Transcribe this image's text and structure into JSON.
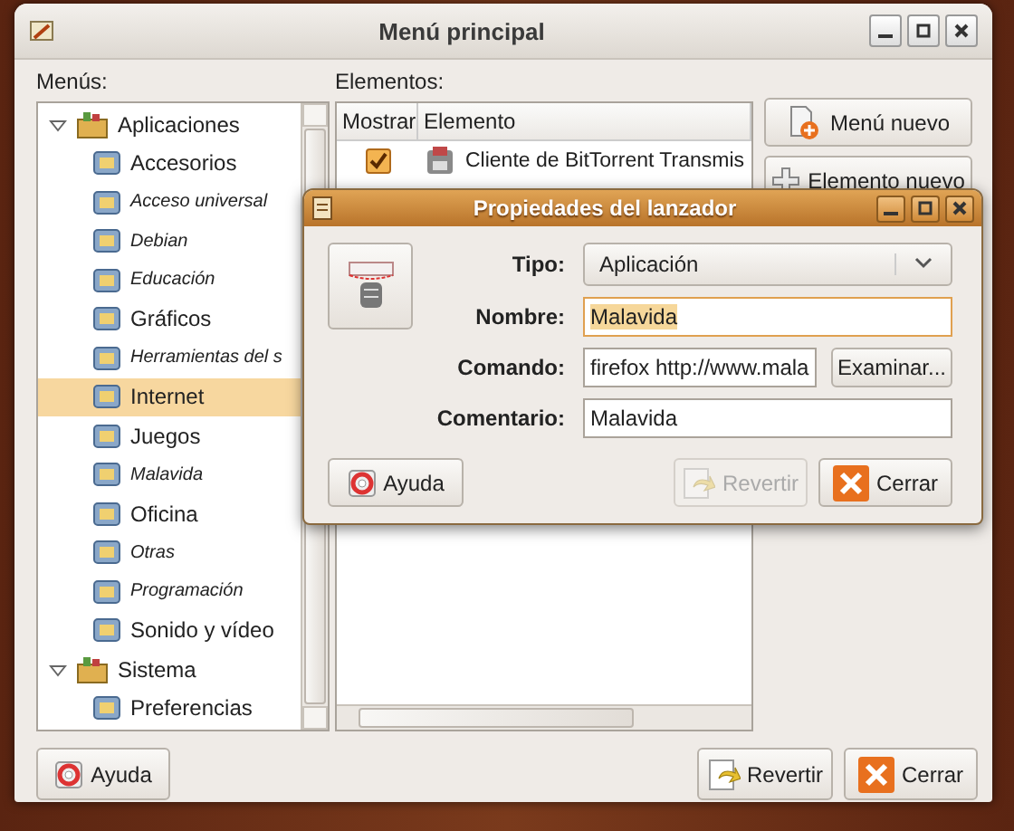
{
  "window": {
    "title": "Menú principal"
  },
  "menus": {
    "label": "Menús:",
    "tree": [
      {
        "label": "Aplicaciones",
        "expanded": true,
        "selected": false,
        "hidden": false,
        "children": [
          {
            "label": "Accesorios",
            "selected": false,
            "hidden": false
          },
          {
            "label": "Acceso universal",
            "selected": false,
            "hidden": true
          },
          {
            "label": "Debian",
            "selected": false,
            "hidden": true
          },
          {
            "label": "Educación",
            "selected": false,
            "hidden": true
          },
          {
            "label": "Gráficos",
            "selected": false,
            "hidden": false
          },
          {
            "label": "Herramientas del s",
            "selected": false,
            "hidden": true
          },
          {
            "label": "Internet",
            "selected": true,
            "hidden": false
          },
          {
            "label": "Juegos",
            "selected": false,
            "hidden": false
          },
          {
            "label": "Malavida",
            "selected": false,
            "hidden": true
          },
          {
            "label": "Oficina",
            "selected": false,
            "hidden": false
          },
          {
            "label": "Otras",
            "selected": false,
            "hidden": true
          },
          {
            "label": "Programación",
            "selected": false,
            "hidden": true
          },
          {
            "label": "Sonido y vídeo",
            "selected": false,
            "hidden": false
          }
        ]
      },
      {
        "label": "Sistema",
        "expanded": true,
        "selected": false,
        "hidden": false,
        "children": [
          {
            "label": "Preferencias",
            "selected": false,
            "hidden": false
          }
        ]
      }
    ]
  },
  "elements": {
    "label": "Elementos:",
    "columns": [
      "Mostrar",
      "Elemento"
    ],
    "rows": [
      {
        "checked": true,
        "name": "Cliente de BitTorrent Transmis"
      }
    ]
  },
  "side_buttons": [
    {
      "label": "Menú nuevo",
      "kind": "new_menu"
    },
    {
      "label": "Elemento nuevo",
      "kind": "new_item"
    }
  ],
  "footer": {
    "help": "Ayuda",
    "buttons": [
      {
        "label": "Revertir",
        "kind": "revert",
        "disabled": false
      },
      {
        "label": "Cerrar",
        "kind": "close",
        "disabled": false
      }
    ]
  },
  "dialog": {
    "title": "Propiedades del lanzador",
    "fields": [
      {
        "label": "Tipo:",
        "kind": "dropdown",
        "value": "Aplicación",
        "focused": false
      },
      {
        "label": "Nombre:",
        "kind": "text",
        "value": "Malavida",
        "focused": true
      },
      {
        "label": "Comando:",
        "kind": "browse",
        "value": "firefox http://www.mala",
        "button": "Examinar...",
        "focused": false
      },
      {
        "label": "Comentario:",
        "kind": "text",
        "value": "Malavida",
        "focused": false
      }
    ],
    "help": "Ayuda",
    "buttons": [
      {
        "label": "Revertir",
        "kind": "revert",
        "disabled": true
      },
      {
        "label": "Cerrar",
        "kind": "close",
        "disabled": false
      }
    ]
  }
}
